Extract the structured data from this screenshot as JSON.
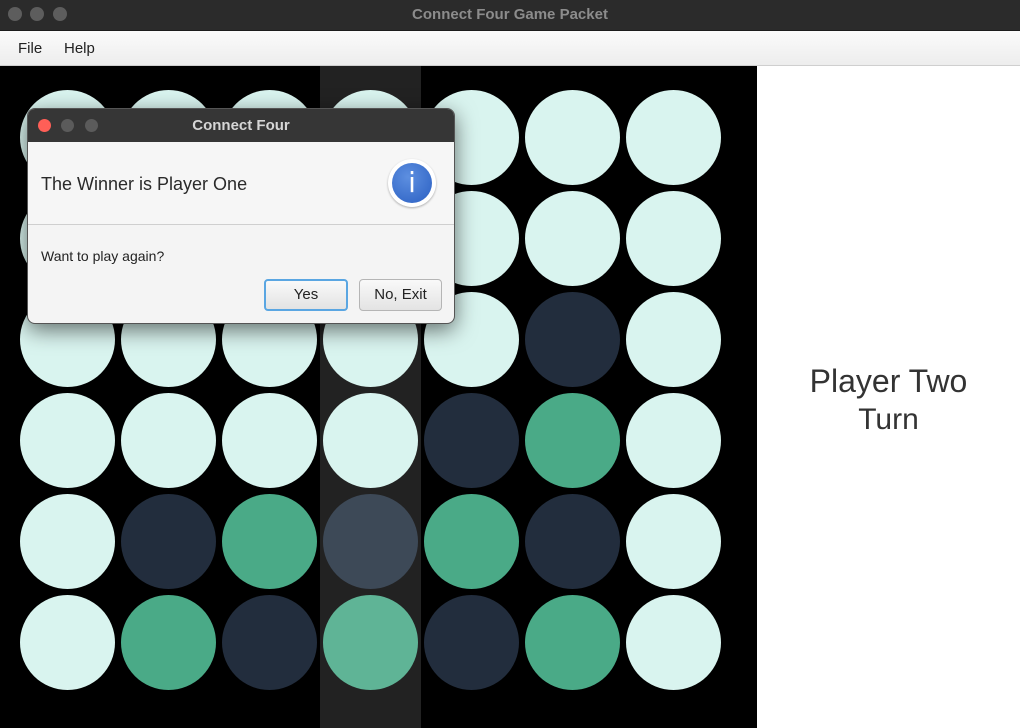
{
  "window": {
    "title": "Connect Four Game Packet"
  },
  "menu": {
    "file": "File",
    "help": "Help"
  },
  "colors": {
    "empty": "#d9f4ef",
    "player_one": "#4aaa87",
    "player_two": "#222d3d",
    "highlight_player_one": "#5fb496",
    "highlight_player_two": "#3d4957",
    "highlight_column_bg": "#222222"
  },
  "board": {
    "rows": 6,
    "columns": 7,
    "highlighted_column": 3,
    "cells": [
      [
        "empty",
        "empty",
        "empty",
        "empty",
        "empty",
        "empty",
        "empty"
      ],
      [
        "empty",
        "empty",
        "empty",
        "empty",
        "empty",
        "empty",
        "empty"
      ],
      [
        "empty",
        "empty",
        "empty",
        "empty",
        "empty",
        "two",
        "empty"
      ],
      [
        "empty",
        "empty",
        "empty",
        "empty",
        "two",
        "one",
        "empty"
      ],
      [
        "empty",
        "two",
        "one",
        "two",
        "one",
        "two",
        "empty"
      ],
      [
        "empty",
        "one",
        "two",
        "one",
        "two",
        "one",
        "empty"
      ]
    ]
  },
  "status": {
    "line1": "Player Two",
    "line2": "Turn"
  },
  "dialog": {
    "title": "Connect Four",
    "header": "The Winner is Player One",
    "icon": "info-icon",
    "icon_glyph": "i",
    "content": "Want to play again?",
    "yes_label": "Yes",
    "no_label": "No, Exit"
  }
}
